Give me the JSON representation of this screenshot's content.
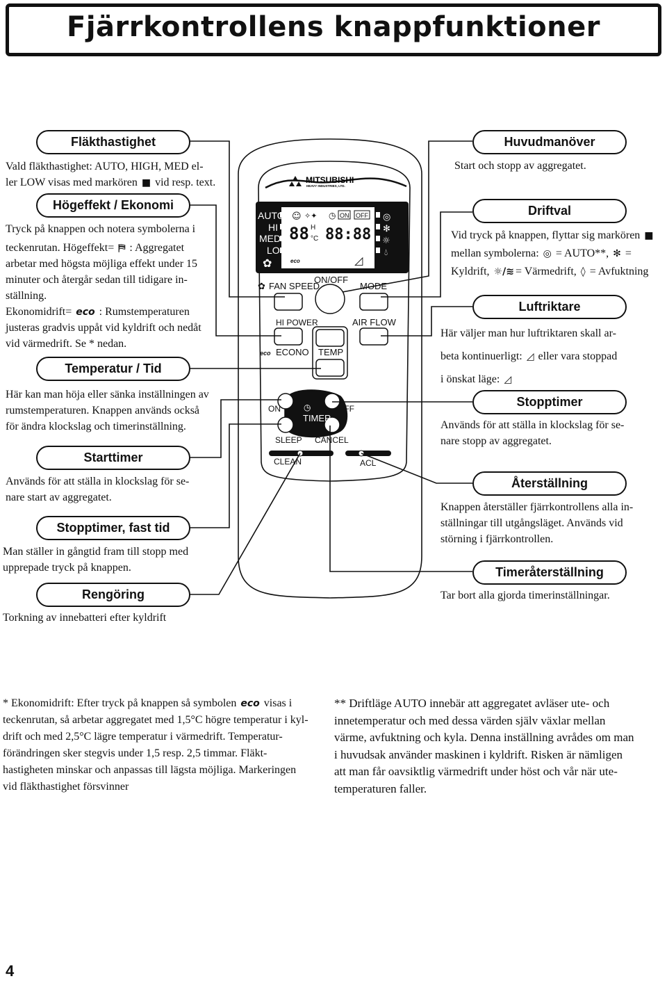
{
  "title": "Fjärrkontrollens knappfunktioner",
  "left": {
    "fan": {
      "label": "Fläkthastighet",
      "lines": [
        "Vald fläkthastighet: AUTO, HIGH, MED el-",
        "ler LOW visas med markören",
        "vid resp. text."
      ]
    },
    "hipower": {
      "label": "Högeffekt / Ekonomi",
      "lines": [
        "Tryck på knappen och notera symbolerna i",
        "teckenrutan. Högeffekt=",
        ": Aggregatet",
        "arbetar med högsta möjliga effekt under 15",
        "minuter och återgår sedan till tidigare in-",
        "ställning.",
        "Ekonomidrift=",
        ": Rumstemperaturen",
        "justeras gradvis uppåt vid kyldrift och nedåt",
        "vid värmedrift. Se * nedan."
      ]
    },
    "temp": {
      "label": "Temperatur / Tid",
      "lines": [
        "Här kan man höja eller sänka inställningen av",
        "rumstemperaturen. Knappen används också",
        "för ändra klockslag och timerinställning."
      ]
    },
    "starttimer": {
      "label": "Starttimer",
      "lines": [
        "Används för att ställa in klockslag för se-",
        "nare start av aggregatet."
      ]
    },
    "sleep": {
      "label": "Stopptimer, fast tid",
      "lines": [
        "Man ställer in gångtid fram till stopp med",
        "upprepade tryck på knappen."
      ]
    },
    "clean": {
      "label": "Rengöring",
      "lines": [
        "Torkning av innebatteri efter kyldrift"
      ]
    }
  },
  "right": {
    "onoff": {
      "label": "Huvudmanöver",
      "lines": [
        "Start och stopp av aggregatet."
      ]
    },
    "mode": {
      "label": "Driftval",
      "lines": [
        "Vid tryck på knappen, flyttar sig markören",
        "mellan symbolerna:",
        "= AUTO**,",
        "=",
        "Kyldrift,",
        "= Värmedrift,",
        "= Avfuktning"
      ]
    },
    "airflow": {
      "label": "Luftriktare",
      "lines": [
        "Här väljer man hur  luftriktaren skall ar-",
        "beta kontinuerligt:",
        "eller vara stoppad",
        "i önskat läge:"
      ]
    },
    "offtimer": {
      "label": "Stopptimer",
      "lines": [
        "Används för att ställa in klockslag för se-",
        "nare stopp av aggregatet."
      ]
    },
    "acl": {
      "label": "Återställning",
      "lines": [
        "Knappen återställer fjärrkontrollens alla in-",
        "ställningar till utgångsläget. Används vid",
        "störning i fjärrkontrollen."
      ]
    },
    "cancel": {
      "label": "Timeråterställning",
      "lines": [
        "Tar bort alla gjorda timerinställningar."
      ]
    }
  },
  "remote": {
    "brand": "MITSUBISHI",
    "brand_sub": "HEAVY INDUSTRIES, LTD.",
    "fan_levels": [
      "AUTO",
      "HI",
      "MED",
      "LO"
    ],
    "display_temp": "88",
    "display_time": "88:88",
    "display_on": "ON",
    "display_off": "OFF",
    "display_h": "H",
    "display_c": "°C",
    "buttons": {
      "fan_speed": "FAN SPEED",
      "on_off": "ON/OFF",
      "mode": "MODE",
      "hi_power": "HI POWER",
      "air_flow": "AIR FLOW",
      "econo": "ECONO",
      "temp": "TEMP",
      "on": "ON",
      "off": "OFF",
      "timer": "TIMER",
      "sleep": "SLEEP",
      "cancel": "CANCEL",
      "clean": "CLEAN",
      "acl": "ACL"
    }
  },
  "footnotes": {
    "left": [
      "* Ekonomidrift: Efter tryck på knappen så symbolen",
      "visas  i",
      "teckenrutan, så arbetar aggregatet med 1,5°C högre temperatur i kyl-",
      "drift och med 2,5°C lägre temperatur i värmedrift. Temperatur-",
      "förändringen sker stegvis under 1,5 resp. 2,5 timmar. Fläkt-",
      "hastigheten minskar och anpassas till lägsta möjliga. Markeringen",
      "vid fläkthastighet försvinner"
    ],
    "right": [
      "** Driftläge AUTO innebär att aggregatet avläser ute- och",
      "innetemperatur och med dessa värden själv växlar mellan",
      "värme, avfuktning och kyla. Denna inställning avrådes om man",
      "i huvudsak använder maskinen i kyldrift. Risken är nämligen",
      "att man får oavsiktlig värmedrift under höst och vår när ute-",
      "temperaturen faller."
    ]
  },
  "page_number": "4"
}
